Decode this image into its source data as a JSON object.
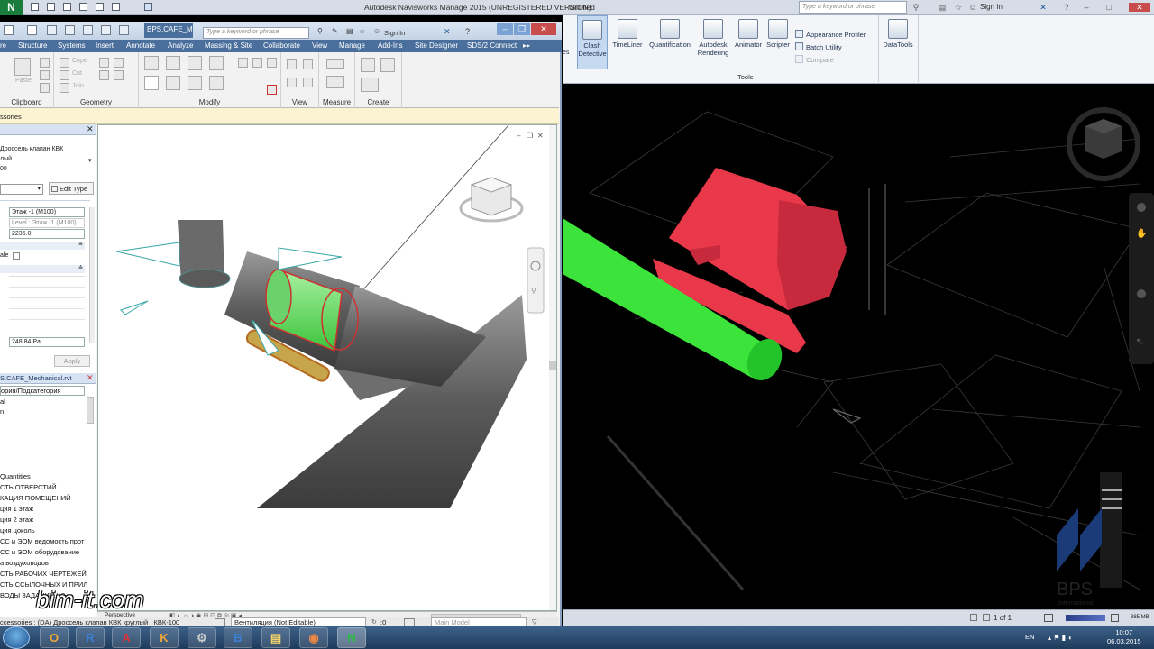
{
  "colors": {
    "clash_red": "#e8384a",
    "clash_green": "#3be33b",
    "revit_tab_blue": "#4a6f9c",
    "nav_bg": "#000000"
  },
  "navisworks": {
    "title": "Autodesk Navisworks Manage 2015 (UNREGISTERED VERSION)",
    "document": "Untitled",
    "search_placeholder": "Type a keyword or phrase",
    "signin": "Sign In",
    "tools": [
      {
        "label": "Clash\nDetective",
        "icon": "clash-detective-icon"
      },
      {
        "label": "TimeLiner",
        "icon": "timeliner-icon"
      },
      {
        "label": "Quantification",
        "icon": "quantification-icon"
      },
      {
        "label": "Autodesk\nRendering",
        "icon": "rendering-icon"
      },
      {
        "label": "Animator",
        "icon": "animator-icon"
      },
      {
        "label": "Scripter",
        "icon": "scripter-icon"
      }
    ],
    "side_tools": [
      "Appearance Profiler",
      "Batch Utility",
      "Compare"
    ],
    "datatools": "DataTools",
    "tools_group_label": "Tools",
    "page_indicator": "1 of 1",
    "memory": "385 MB"
  },
  "revit": {
    "doc_tab": "BPS.CAFE_M...",
    "search_placeholder": "Type a keyword or phrase",
    "signin": "Sign In",
    "tabs": [
      "re",
      "Structure",
      "Systems",
      "Insert",
      "Annotate",
      "Analyze",
      "Massing & Site",
      "Collaborate",
      "View",
      "Manage",
      "Add-Ins",
      "Site Designer",
      "SDS/2 Connect"
    ],
    "ribbon_groups": [
      "Clipboard",
      "Geometry",
      "Modify",
      "View",
      "Measure",
      "Create"
    ],
    "ribbon_small": {
      "paste": "Paste",
      "cope": "Cope",
      "cut": "Cut",
      "join": "Join"
    },
    "option_bar": "ssories",
    "properties": {
      "type_line1": "Дроссель клапан КВК",
      "type_line2": "лый",
      "type_line3": "00",
      "edit_type": "Edit Type",
      "level_value": "Этаж -1 (M100)",
      "level_value2": "Level : Этаж -1 (M100)",
      "offset_value": "2235.0",
      "scale_label": "ale",
      "pressure_value": "248.84 Pa",
      "apply": "Apply"
    },
    "browser": {
      "title": "S.CAFE_Mechanical.rvt",
      "items": [
        "ория/Подкатегория",
        "al",
        "n",
        "",
        "",
        "",
        "",
        "",
        "Quantities",
        "СТЬ ОТВЕРСТИЙ",
        "КАЦИЯ ПОМЕЩЕНИЙ",
        "ция 1 этаж",
        "ция 2 этаж",
        "ция цоколь",
        "СС и ЭОМ ведомость прот",
        "СС и ЭОМ оборудование",
        "а воздуховодов",
        "СТЬ РАБОЧИХ ЧЕРТЕЖЕЙ",
        "СТЬ ССЫЛОЧНЫХ И ПРИЛ",
        "ВОДЫ ЗАДАНИЯ ИЗ"
      ]
    },
    "status_left": "ccessories : (DA) Дроссель клапан КВК круглый : КВК-100",
    "status_workset": "Вентиляция (Not Editable)",
    "status_model": "Main Model",
    "status_zero": ":0",
    "viewbar_perspective": "Perspective"
  },
  "watermark": {
    "site": "bim-it.com",
    "logo_text": "BPS",
    "logo_sub": "International"
  },
  "taskbar": {
    "apps": [
      {
        "name": "explorer-app",
        "glyph": "▢"
      },
      {
        "name": "outlook-app",
        "glyph": "O"
      },
      {
        "name": "revit-app",
        "glyph": "R"
      },
      {
        "name": "autocad-app",
        "glyph": "A"
      },
      {
        "name": "k-app",
        "glyph": "K"
      },
      {
        "name": "tool-app",
        "glyph": "⚙"
      },
      {
        "name": "b-app",
        "glyph": "B"
      },
      {
        "name": "folder-app",
        "glyph": "▤"
      },
      {
        "name": "chrome-app",
        "glyph": "◉"
      },
      {
        "name": "navisworks-app",
        "glyph": "N"
      }
    ],
    "lang": "EN",
    "time": "10:07",
    "date": "06.03.2015"
  }
}
